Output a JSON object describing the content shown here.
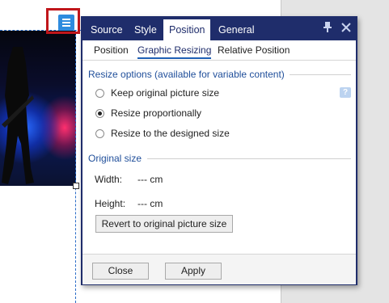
{
  "dialog": {
    "tabs": [
      {
        "label": "Source"
      },
      {
        "label": "Style"
      },
      {
        "label": "Position"
      },
      {
        "label": "General"
      }
    ],
    "active_tab": "Position",
    "subtabs": [
      {
        "label": "Position"
      },
      {
        "label": "Graphic Resizing"
      },
      {
        "label": "Relative Position"
      }
    ],
    "active_subtab": "Graphic Resizing",
    "resize_section": {
      "title": "Resize options (available for variable content)",
      "options": [
        {
          "label": "Keep original picture size",
          "checked": false
        },
        {
          "label": "Resize proportionally",
          "checked": true
        },
        {
          "label": "Resize to the designed size",
          "checked": false
        }
      ]
    },
    "original_size": {
      "title": "Original size",
      "width_label": "Width:",
      "width_value": "--- cm",
      "height_label": "Height:",
      "height_value": "--- cm",
      "revert_label": "Revert to original picture size"
    },
    "footer": {
      "close_label": "Close",
      "apply_label": "Apply"
    }
  },
  "colors": {
    "dialog_header": "#1f2d6b",
    "accent": "#1f4e9a",
    "highlight_border": "#c0161b",
    "menu_button": "#2e8bde"
  },
  "icons": {
    "menu": "hamburger-menu-icon",
    "pin": "pin-icon",
    "close": "close-icon",
    "help": "help-icon"
  }
}
